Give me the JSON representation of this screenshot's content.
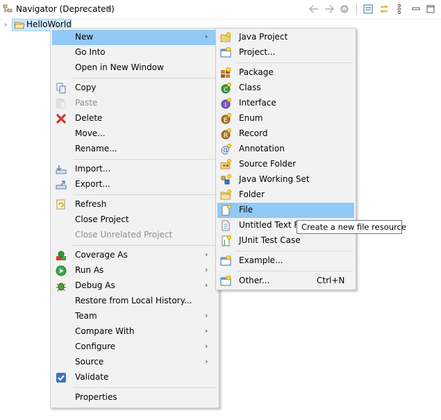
{
  "view": {
    "title": "Navigator (Deprecated)",
    "close_glyph": "⊠",
    "toolbar_icons": [
      "back-icon",
      "forward-icon",
      "home-icon",
      "collapse-all-icon",
      "link-with-editor-icon",
      "view-menu-icon",
      "minimize-icon",
      "maximize-icon"
    ]
  },
  "tree": {
    "project": "HelloWorld",
    "expand_glyph": "›"
  },
  "context_menu": {
    "items": [
      {
        "label": "New",
        "icon": "",
        "submenu": true,
        "highlighted": true
      },
      {
        "label": "Go Into",
        "icon": ""
      },
      {
        "label": "Open in New Window",
        "icon": ""
      },
      {
        "label": "Copy",
        "icon": "copy-icon"
      },
      {
        "label": "Paste",
        "icon": "paste-icon",
        "disabled": true
      },
      {
        "label": "Delete",
        "icon": "delete-icon"
      },
      {
        "label": "Move...",
        "icon": ""
      },
      {
        "label": "Rename...",
        "icon": ""
      },
      {
        "label": "Import...",
        "icon": "import-icon"
      },
      {
        "label": "Export...",
        "icon": "export-icon"
      },
      {
        "label": "Refresh",
        "icon": "refresh-icon"
      },
      {
        "label": "Close Project",
        "icon": ""
      },
      {
        "label": "Close Unrelated Project",
        "icon": "",
        "disabled": true
      },
      {
        "label": "Coverage As",
        "icon": "coverage-icon",
        "submenu": true
      },
      {
        "label": "Run As",
        "icon": "run-icon",
        "submenu": true
      },
      {
        "label": "Debug As",
        "icon": "debug-icon",
        "submenu": true
      },
      {
        "label": "Restore from Local History...",
        "icon": ""
      },
      {
        "label": "Team",
        "icon": "",
        "submenu": true
      },
      {
        "label": "Compare With",
        "icon": "",
        "submenu": true
      },
      {
        "label": "Configure",
        "icon": "",
        "submenu": true
      },
      {
        "label": "Source",
        "icon": "",
        "submenu": true
      },
      {
        "label": "Validate",
        "icon": "check-icon"
      },
      {
        "label": "Properties",
        "icon": ""
      }
    ],
    "arrow_glyph": "›"
  },
  "new_submenu": {
    "items": [
      {
        "label": "Java Project",
        "icon": "java-project-icon"
      },
      {
        "label": "Project...",
        "icon": "project-icon"
      },
      {
        "label": "Package",
        "icon": "package-icon"
      },
      {
        "label": "Class",
        "icon": "class-icon"
      },
      {
        "label": "Interface",
        "icon": "interface-icon"
      },
      {
        "label": "Enum",
        "icon": "enum-icon"
      },
      {
        "label": "Record",
        "icon": "record-icon"
      },
      {
        "label": "Annotation",
        "icon": "annotation-icon"
      },
      {
        "label": "Source Folder",
        "icon": "source-folder-icon"
      },
      {
        "label": "Java Working Set",
        "icon": "working-set-icon"
      },
      {
        "label": "Folder",
        "icon": "folder-icon"
      },
      {
        "label": "File",
        "icon": "file-icon",
        "highlighted": true
      },
      {
        "label": "Untitled Text File",
        "icon": "text-file-icon"
      },
      {
        "label": "JUnit Test Case",
        "icon": "junit-icon"
      },
      {
        "label": "Example...",
        "icon": "example-icon"
      },
      {
        "label": "Other...",
        "icon": "other-icon",
        "accelerator": "Ctrl+N"
      }
    ]
  },
  "tooltip": {
    "text": "Create a new file resource"
  },
  "colors": {
    "menu_bg": "#f2f2f2",
    "highlight": "#91c9f7",
    "selection": "#cce8ff",
    "disabled_text": "#8d8d8d"
  }
}
